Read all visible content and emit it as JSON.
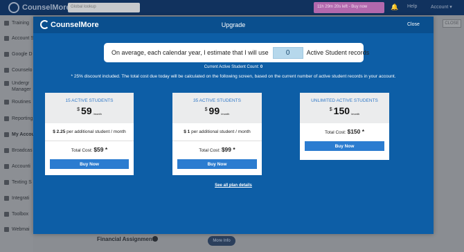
{
  "topbar": {
    "logo_text": "CounselMore",
    "search_placeholder": "Global lookup",
    "promo_text": "11h 29m 20s left - Buy now",
    "help_label": "Help",
    "account_label": "Account ▾"
  },
  "sidebar": {
    "items": [
      {
        "label": "Training"
      },
      {
        "label": "Account S"
      },
      {
        "label": "Google D"
      },
      {
        "label": "Counselo"
      },
      {
        "label": "Undergr"
      },
      {
        "label": "Manager"
      },
      {
        "label": "Routines"
      },
      {
        "label": "Reporting"
      },
      {
        "label": "My Accou"
      },
      {
        "label": "Broadcas"
      },
      {
        "label": "Accounti"
      },
      {
        "label": "Texting S"
      },
      {
        "label": "Integrati"
      },
      {
        "label": "Toolbox"
      },
      {
        "label": "Webmai"
      }
    ]
  },
  "background": {
    "close_label": "CLOSE",
    "financial_assignments": "Financial Assignments",
    "more_info": "More Info"
  },
  "modal": {
    "logo_text": "CounselMore",
    "title": "Upgrade",
    "close_label": "Close",
    "estimate_prefix": "On average, each calendar year, I estimate that I will use",
    "estimate_value": "0",
    "estimate_suffix": "Active Student records",
    "current_count_label": "Current Active Student Count:",
    "current_count_value": "0",
    "discount_note": "* 25% discount included. The total cost due today will be calculated on the following screen, based on the current number of active student records in your account.",
    "plans": [
      {
        "name": "15 Active Students",
        "currency": "$",
        "price": "59",
        "period": "/month",
        "additional_price": "$ 2.25",
        "additional_text": "per additional student / month",
        "total_label": "Total Cost:",
        "total_value": "$59 *",
        "buy_label": "Buy Now"
      },
      {
        "name": "35 Active Students",
        "currency": "$",
        "price": "99",
        "period": "/month",
        "additional_price": "$ 1",
        "additional_text": "per additional student / month",
        "total_label": "Total Cost:",
        "total_value": "$99 *",
        "buy_label": "Buy Now"
      },
      {
        "name": "Unlimited Active Students",
        "currency": "$",
        "price": "150",
        "period": "/month",
        "total_label": "Total Cost:",
        "total_value": "$150 *",
        "buy_label": "Buy Now"
      }
    ],
    "plan_details_link": "See all plan details"
  }
}
